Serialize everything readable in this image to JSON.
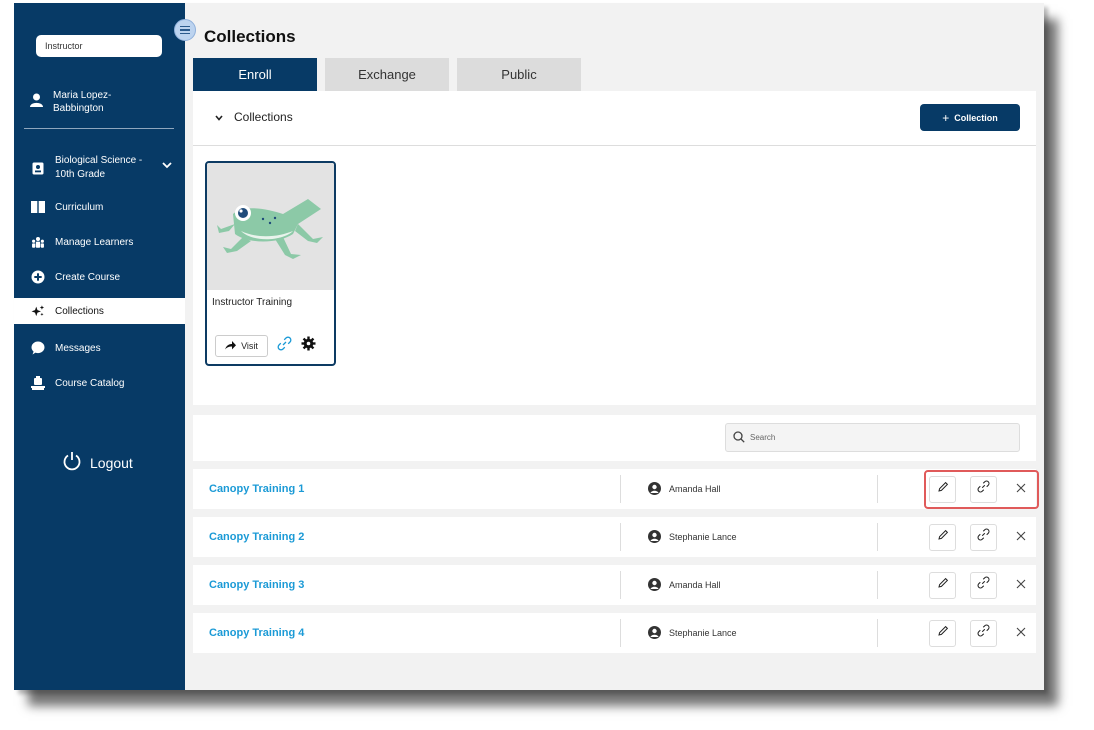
{
  "sidebar": {
    "role_value": "Instructor",
    "user_name": "Maria Lopez-Babbington",
    "user_name_line1": "Maria Lopez-",
    "user_name_line2": "Babbington",
    "course_line1": "Biological Science -",
    "course_line2": "10th Grade",
    "items": [
      {
        "label": "Curriculum",
        "icon": "book-icon"
      },
      {
        "label": "Manage Learners",
        "icon": "users-icon"
      },
      {
        "label": "Create Course",
        "icon": "plus-circle-icon"
      },
      {
        "label": "Collections",
        "icon": "sparkle-icon",
        "active": true
      },
      {
        "label": "Messages",
        "icon": "chat-bubble-icon"
      },
      {
        "label": "Course Catalog",
        "icon": "catalog-icon"
      }
    ],
    "logout_label": "Logout"
  },
  "main": {
    "page_title": "Collections",
    "tabs": [
      {
        "label": "Enroll",
        "active": true
      },
      {
        "label": "Exchange",
        "active": false
      },
      {
        "label": "Public",
        "active": false
      }
    ],
    "panel": {
      "section_label": "Collections",
      "add_button_label": "Collection",
      "card": {
        "title": "Instructor Training",
        "visit_label": "Visit"
      }
    },
    "search": {
      "placeholder": "Search"
    },
    "rows": [
      {
        "name": "Canopy Training 1",
        "owner": "Amanda Hall"
      },
      {
        "name": "Canopy Training 2",
        "owner": "Stephanie Lance"
      },
      {
        "name": "Canopy Training 3",
        "owner": "Amanda Hall"
      },
      {
        "name": "Canopy Training 4",
        "owner": "Stephanie Lance"
      }
    ]
  },
  "colors": {
    "navy": "#073a66",
    "link_blue": "#1b9ad6",
    "highlight_red": "#e05a5a",
    "frog_green": "#8cc9a7"
  }
}
